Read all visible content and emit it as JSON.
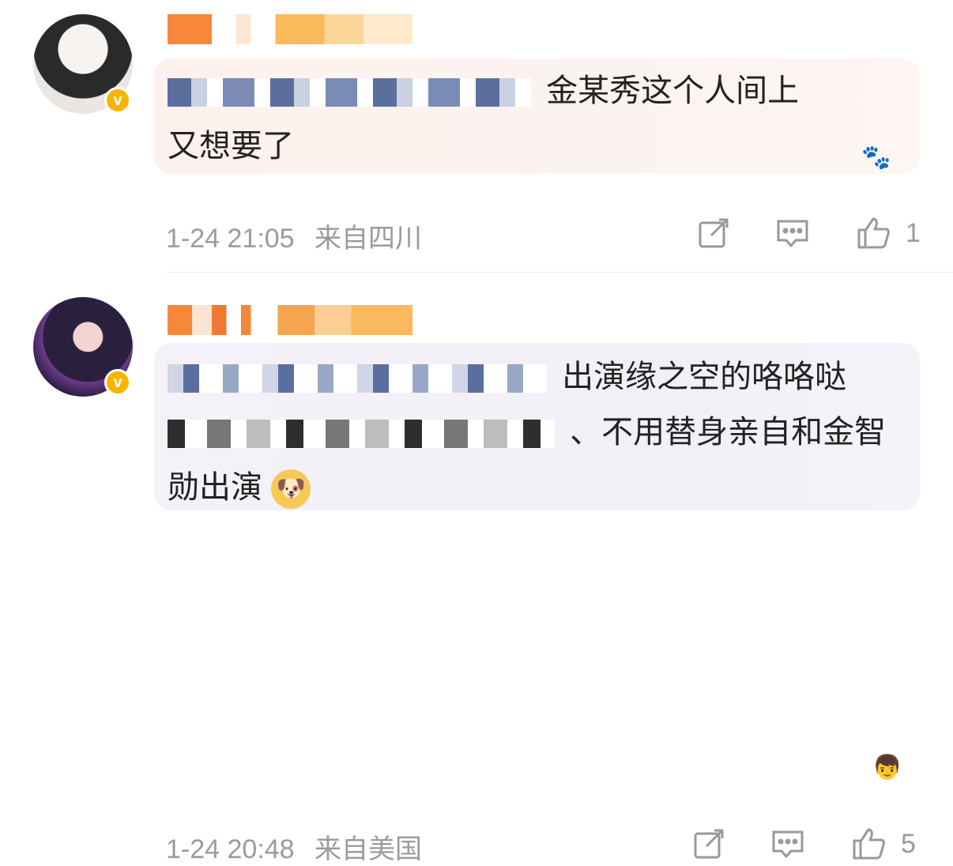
{
  "comments": [
    {
      "text_line1": "金某秀这个人间上",
      "text_line2": "又想要了",
      "time": "1-24 21:05",
      "location": "来自四川",
      "likes": "1"
    },
    {
      "text_line1": "出演缘之空的咯咯哒",
      "text_line2": "、不用替身亲自和金智",
      "text_line3": "勋出演",
      "time": "1-24 20:48",
      "location": "来自美国",
      "likes": "5"
    }
  ],
  "icons": {
    "verified": "v-badge-icon",
    "share": "share-icon",
    "reply": "comment-icon",
    "like": "thumbs-up-icon",
    "emoji": "doge-emoji-icon"
  },
  "badge_letter": "v",
  "emoji_glyph": "🐶",
  "accent_color": "#f7b500"
}
